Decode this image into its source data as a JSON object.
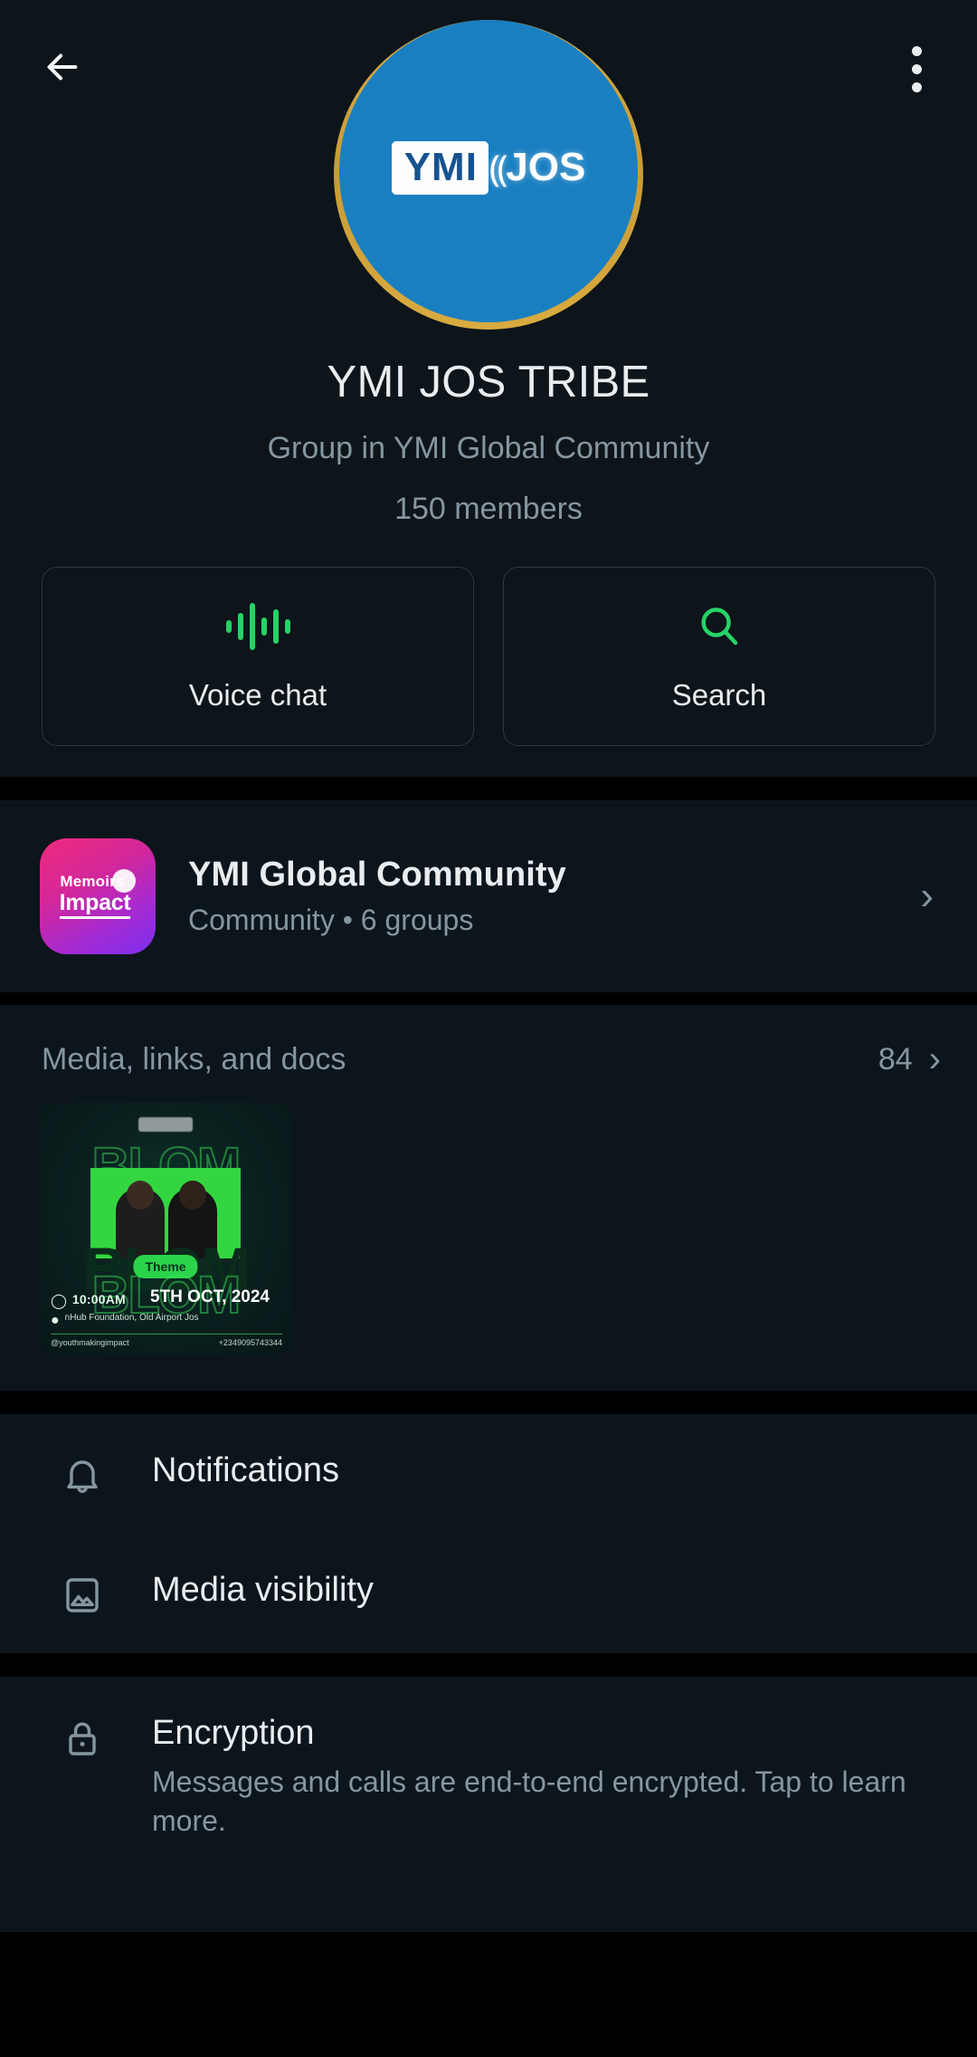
{
  "topbar": {
    "back_icon": "back-arrow-icon",
    "overflow_icon": "more-vertical-icon"
  },
  "avatar": {
    "icon": "group-avatar",
    "logo_primary": "YMI",
    "logo_separator": "⸨",
    "logo_secondary": "JOS",
    "ring_color": "#d9ab3f",
    "fill_color": "#1a7fc1"
  },
  "header": {
    "title": "YMI JOS TRIBE",
    "subtitle": "Group in YMI Global Community",
    "members": "150 members"
  },
  "actions": [
    {
      "label": "Voice chat",
      "icon": "voice-waveform-icon",
      "color": "#25d366"
    },
    {
      "label": "Search",
      "icon": "search-icon",
      "color": "#25d366"
    }
  ],
  "community": {
    "name": "YMI Global Community",
    "meta": "Community • 6 groups",
    "chevron": "›",
    "icon": "community-avatar",
    "icon_top_text": "Memoirs",
    "icon_bottom_text": "Impact"
  },
  "media": {
    "title": "Media, links, and docs",
    "count": "84",
    "chevron": "›",
    "items": [
      {
        "name": "bloom-event-flyer",
        "ghost_word": "BLOM",
        "headline": "BLOM",
        "theme_label": "Theme",
        "time": "10:00AM",
        "venue": "nHub Foundation,\nOld Airport Jos",
        "date": "5TH OCT,\n2024",
        "handle": "@youthmakingimpact",
        "phone": "+2349095743344"
      }
    ]
  },
  "settings": [
    {
      "title": "Notifications",
      "desc": "",
      "icon": "bell-icon"
    },
    {
      "title": "Media visibility",
      "desc": "",
      "icon": "image-icon"
    },
    {
      "title": "Encryption",
      "desc": "Messages and calls are end-to-end encrypted. Tap to learn more.",
      "icon": "lock-icon"
    }
  ],
  "theme": {
    "background": "#000000",
    "surface": "#0d151c",
    "hero_surface": "#0d141a",
    "text_primary": "#e9edef",
    "text_secondary": "#8696a0",
    "accent": "#25d366"
  }
}
